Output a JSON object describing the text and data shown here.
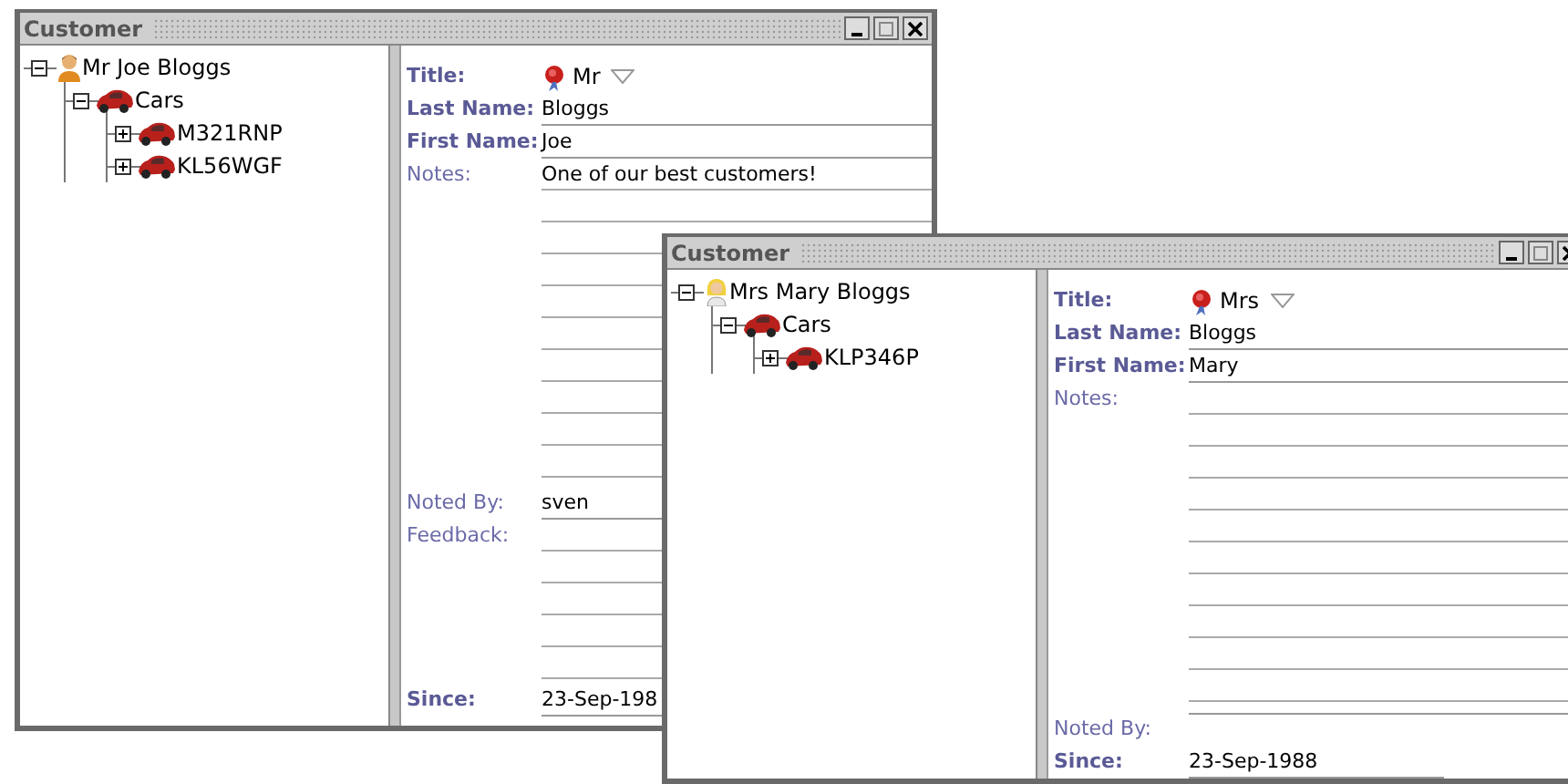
{
  "windows": [
    {
      "title": "Customer",
      "tree": [
        {
          "label": "Mr Joe Bloggs",
          "kind": "man",
          "expanded": true,
          "children": [
            {
              "label": "Cars",
              "kind": "car",
              "expanded": true,
              "children": [
                {
                  "label": "M321RNP",
                  "kind": "car",
                  "expanded": false
                },
                {
                  "label": "KL56WGF",
                  "kind": "car",
                  "expanded": false
                }
              ]
            }
          ]
        }
      ],
      "fields": [
        {
          "label": "Title:",
          "required": true,
          "kind": "combo",
          "value": "Mr"
        },
        {
          "label": "Last Name:",
          "required": true,
          "kind": "text",
          "value": "Bloggs"
        },
        {
          "label": "First Name:",
          "required": true,
          "kind": "text",
          "value": "Joe"
        },
        {
          "label": "Notes:",
          "required": false,
          "kind": "memo",
          "value": "One of our best customers!"
        },
        {
          "label": "Noted By:",
          "required": false,
          "kind": "text",
          "value": "sven"
        },
        {
          "label": "Feedback:",
          "required": false,
          "kind": "memo"
        },
        {
          "label": "Since:",
          "required": true,
          "kind": "date",
          "value": "23-Sep-198"
        }
      ]
    },
    {
      "title": "Customer",
      "tree": [
        {
          "label": "Mrs Mary Bloggs",
          "kind": "woman",
          "expanded": true,
          "children": [
            {
              "label": "Cars",
              "kind": "car",
              "expanded": true,
              "children": [
                {
                  "label": "KLP346P",
                  "kind": "car",
                  "expanded": false
                }
              ]
            }
          ]
        }
      ],
      "fields": [
        {
          "label": "Title:",
          "required": true,
          "kind": "combo",
          "value": "Mrs"
        },
        {
          "label": "Last Name:",
          "required": true,
          "kind": "text",
          "value": "Bloggs"
        },
        {
          "label": "First Name:",
          "required": true,
          "kind": "text",
          "value": "Mary"
        },
        {
          "label": "Notes:",
          "required": false,
          "kind": "memo"
        },
        {
          "label": "Noted By:",
          "required": false,
          "kind": "text"
        },
        {
          "label": "Since:",
          "required": true,
          "kind": "date",
          "value": "23-Sep-1988"
        }
      ]
    }
  ]
}
